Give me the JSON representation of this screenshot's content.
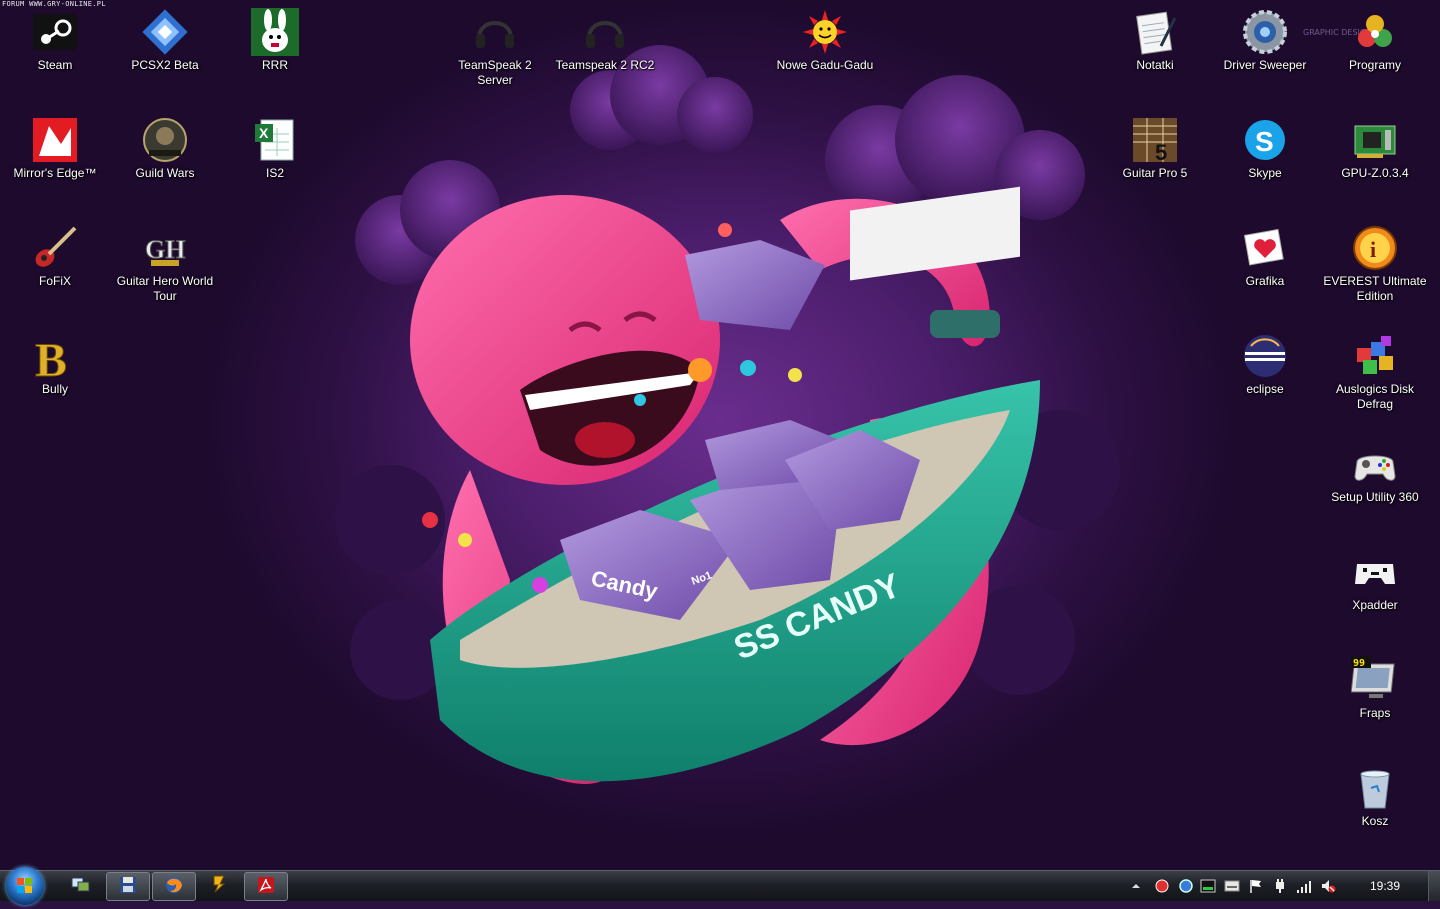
{
  "watermark": "FORUM WWW.GRY-ONLINE.PL",
  "wallpaper": {
    "ship_name": "SS CANDY",
    "crate_text": "Candy",
    "crate_badge": "No1",
    "graphic_design_text": "GRAPHIC DESIGN"
  },
  "icons": [
    {
      "label": "Steam",
      "icon": "steam-icon"
    },
    {
      "label": "PCSX2 Beta",
      "icon": "pcsx2-icon"
    },
    {
      "label": "RRR",
      "icon": "rabbids-icon"
    },
    {
      "label": "TeamSpeak 2 Server",
      "icon": "headphones-icon"
    },
    {
      "label": "Teamspeak 2 RC2",
      "icon": "headphones-icon"
    },
    {
      "label": "Nowe Gadu-Gadu",
      "icon": "sun-smiley-icon"
    },
    {
      "label": "Notatki",
      "icon": "notepad-icon"
    },
    {
      "label": "Driver Sweeper",
      "icon": "gear-icon"
    },
    {
      "label": "Programy",
      "icon": "folder-icon"
    },
    {
      "label": "Mirror's Edge™",
      "icon": "mirrors-edge-icon"
    },
    {
      "label": "Guild Wars",
      "icon": "guild-wars-icon"
    },
    {
      "label": "IS2",
      "icon": "excel-icon"
    },
    {
      "label": "Guitar Pro 5",
      "icon": "guitar-pro-icon"
    },
    {
      "label": "Skype",
      "icon": "skype-icon"
    },
    {
      "label": "GPU-Z.0.3.4",
      "icon": "gpu-card-icon"
    },
    {
      "label": "FoFiX",
      "icon": "guitar-icon"
    },
    {
      "label": "Guitar Hero World Tour",
      "icon": "gh-logo-icon"
    },
    {
      "label": "Grafika",
      "icon": "heart-picture-icon"
    },
    {
      "label": "EVEREST Ultimate Edition",
      "icon": "info-icon"
    },
    {
      "label": "Bully",
      "icon": "bully-icon"
    },
    {
      "label": "eclipse",
      "icon": "eclipse-icon"
    },
    {
      "label": "Auslogics Disk Defrag",
      "icon": "defrag-icon"
    },
    {
      "label": "Setup Utility 360",
      "icon": "xbox-controller-icon"
    },
    {
      "label": "Xpadder",
      "icon": "gamepad-icon"
    },
    {
      "label": "Fraps",
      "icon": "fraps-monitor-icon"
    },
    {
      "label": "Kosz",
      "icon": "recycle-bin-icon"
    }
  ],
  "taskbar": {
    "start": "windows-start-icon",
    "pinned": [
      {
        "icon": "show-desktop-windows-icon"
      },
      {
        "icon": "floppy-save-icon"
      },
      {
        "icon": "firefox-icon"
      },
      {
        "icon": "winamp-icon"
      },
      {
        "icon": "acrobat-icon"
      }
    ],
    "tray": [
      {
        "icon": "chevron-up-icon"
      },
      {
        "icon": "red-dot-icon"
      },
      {
        "icon": "blue-circle-icon"
      },
      {
        "icon": "cpu-meter-icon"
      },
      {
        "icon": "keyboard-icon"
      },
      {
        "icon": "flag-icon"
      },
      {
        "icon": "power-plug-icon"
      },
      {
        "icon": "network-bars-icon"
      },
      {
        "icon": "speaker-muted-icon"
      }
    ],
    "clock": "19:39"
  },
  "colors": {
    "wallpaper_purple": "#4a1d6a",
    "octopus_pink": "#ef3f8f",
    "ship_teal": "#1fa790",
    "crate_purple": "#8e6bc7",
    "taskbar": "#1d2026"
  }
}
